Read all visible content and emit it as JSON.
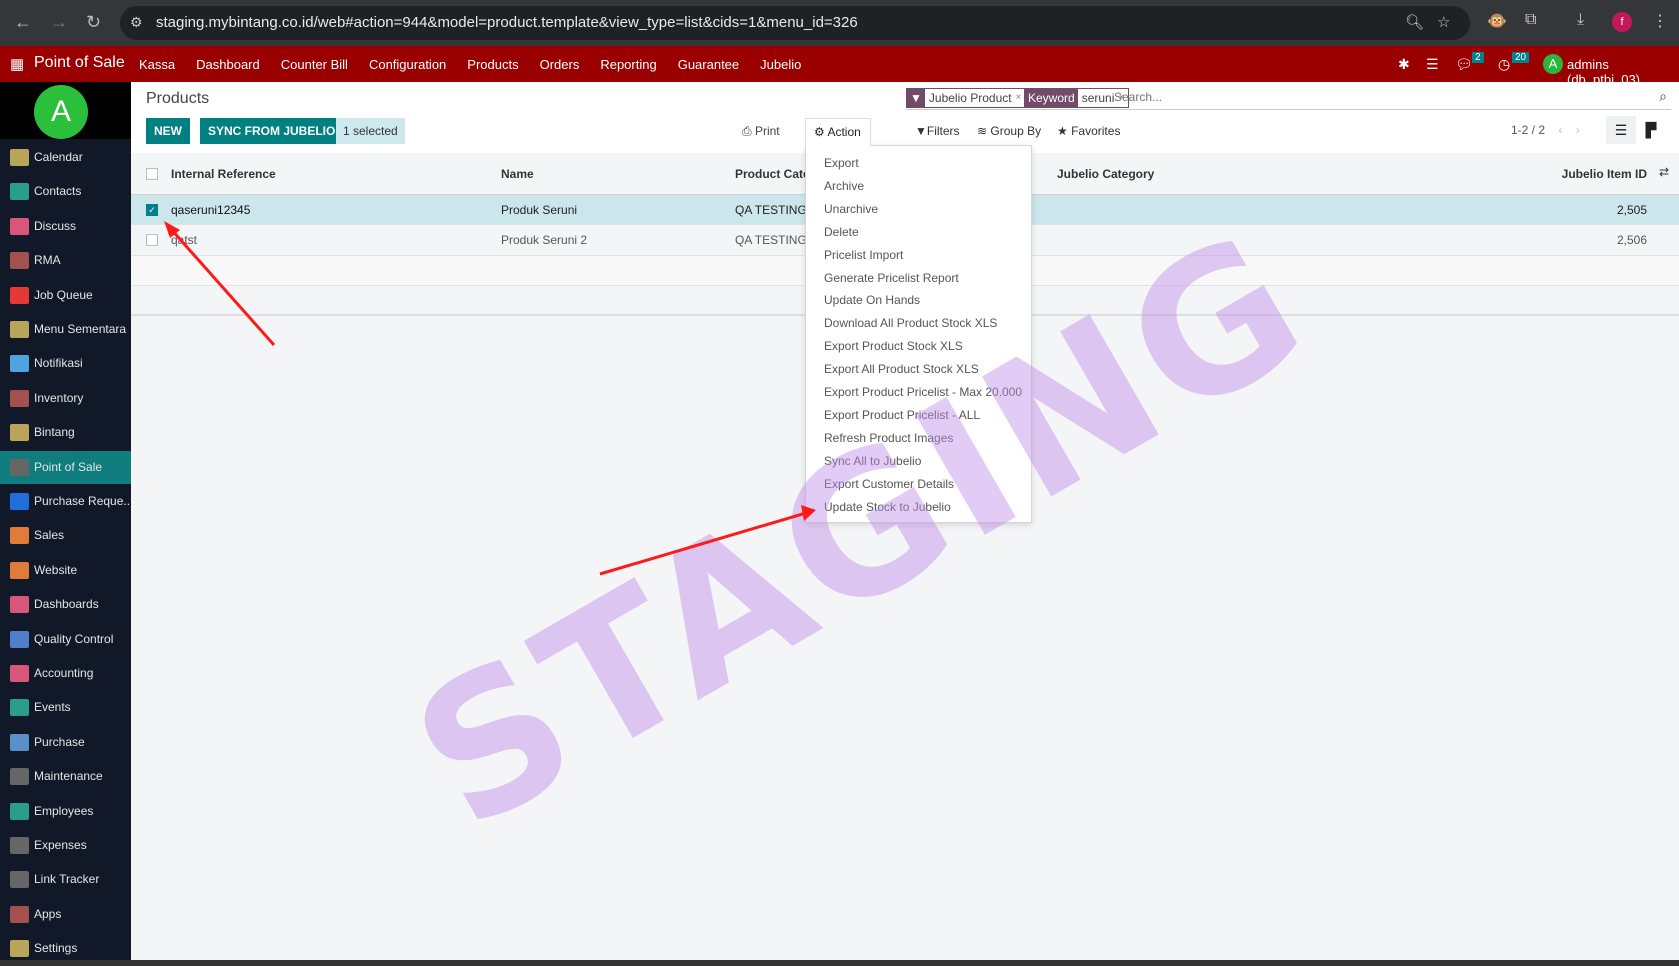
{
  "browser": {
    "url": "staging.mybintang.co.id/web#action=944&model=product.template&view_type=list&cids=1&menu_id=326",
    "profile_initial": "f"
  },
  "navbar": {
    "app": "Point of Sale",
    "menu": [
      "Kassa",
      "Dashboard",
      "Counter Bill",
      "Configuration",
      "Products",
      "Orders",
      "Reporting",
      "Guarantee",
      "Jubelio"
    ],
    "messages_count": "2",
    "activities_count": "20",
    "user_initial": "A",
    "user": "admins (db_ptbi_03)"
  },
  "sidebar": {
    "avatar_initial": "A",
    "active": "Point of Sale",
    "items": [
      {
        "label": "Calendar",
        "color": "#b8a55a"
      },
      {
        "label": "Contacts",
        "color": "#2a9d8f"
      },
      {
        "label": "Discuss",
        "color": "#d9557a"
      },
      {
        "label": "RMA",
        "color": "#a3504e"
      },
      {
        "label": "Job Queue",
        "color": "#e53935"
      },
      {
        "label": "Menu Sementara",
        "color": "#b8a55a"
      },
      {
        "label": "Notifikasi",
        "color": "#4fa3e0"
      },
      {
        "label": "Inventory",
        "color": "#a3504e"
      },
      {
        "label": "Bintang",
        "color": "#b8a55a"
      },
      {
        "label": "Point of Sale",
        "color": "#666"
      },
      {
        "label": "Purchase Reque...",
        "color": "#1e6fd9"
      },
      {
        "label": "Sales",
        "color": "#e07b39"
      },
      {
        "label": "Website",
        "color": "#e07b39"
      },
      {
        "label": "Dashboards",
        "color": "#d9557a"
      },
      {
        "label": "Quality Control",
        "color": "#4f7fc9"
      },
      {
        "label": "Accounting",
        "color": "#d9557a"
      },
      {
        "label": "Events",
        "color": "#2a9d8f"
      },
      {
        "label": "Purchase",
        "color": "#5b8fc9"
      },
      {
        "label": "Maintenance",
        "color": "#666"
      },
      {
        "label": "Employees",
        "color": "#2a9d8f"
      },
      {
        "label": "Expenses",
        "color": "#666"
      },
      {
        "label": "Link Tracker",
        "color": "#666"
      },
      {
        "label": "Apps",
        "color": "#a3504e"
      },
      {
        "label": "Settings",
        "color": "#b8a55a"
      }
    ]
  },
  "control": {
    "title": "Products",
    "new": "NEW",
    "sync": "SYNC FROM JUBELIO",
    "selected": "1 selected",
    "print": "Print",
    "action": "Action",
    "filters": "Filters",
    "group_by": "Group By",
    "favorites": "Favorites",
    "pager": "1-2 / 2"
  },
  "search": {
    "facets": [
      {
        "tag": "Jubelio Product",
        "value": ""
      },
      {
        "tag": "Keyword",
        "value": "seruni"
      }
    ],
    "placeholder": "Search..."
  },
  "table": {
    "columns": [
      "Internal Reference",
      "Name",
      "Product Cate",
      "Jubelio Category",
      "Jubelio Item ID"
    ],
    "rows": [
      {
        "ref": "qaseruni12345",
        "name": "Produk Seruni",
        "categ": "QA TESTING",
        "jcat": "",
        "id": "2,505",
        "selected": true
      },
      {
        "ref": "qatst",
        "name": "Produk Seruni 2",
        "categ": "QA TESTING",
        "jcat": "",
        "id": "2,506",
        "selected": false
      }
    ]
  },
  "action_menu": [
    "Export",
    "Archive",
    "Unarchive",
    "Delete",
    "Pricelist Import",
    "Generate Pricelist Report",
    "Update On Hands",
    "Download All Product Stock XLS",
    "Export Product Stock XLS",
    "Export All Product Stock XLS",
    "Export Product Pricelist - Max 20.000",
    "Export Product Pricelist - ALL",
    "Refresh Product Images",
    "Sync All to Jubelio",
    "Export Customer Details",
    "Update Stock to Jubelio"
  ],
  "watermark": "STAGING",
  "colors": {
    "navbar": "#9a0000",
    "primary": "#008080",
    "selected_row": "#cbe7ec",
    "facet": "#714b67",
    "annotation": "#ff0000"
  }
}
